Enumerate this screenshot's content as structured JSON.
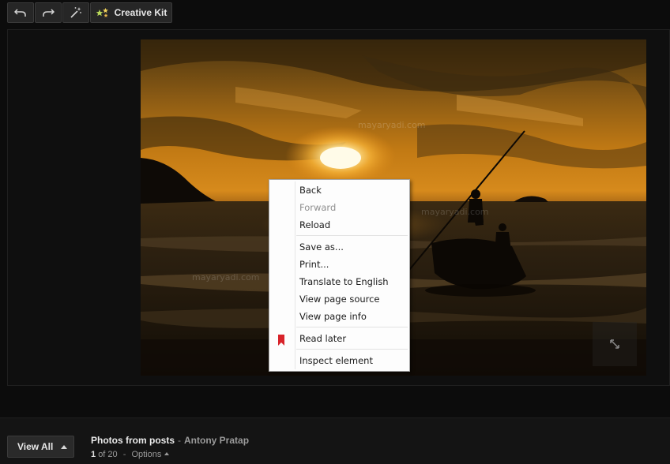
{
  "toolbar": {
    "undo_icon": "undo-icon",
    "redo_icon": "redo-icon",
    "autofix_icon": "magic-wand-icon",
    "creative_kit_label": "Creative Kit"
  },
  "photo": {
    "watermarks": [
      "mayaryadi.com",
      "mayaryadi.com",
      "mayaryadi.com"
    ]
  },
  "context_menu": {
    "items": [
      {
        "label": "Back",
        "enabled": true
      },
      {
        "label": "Forward",
        "enabled": false
      },
      {
        "label": "Reload",
        "enabled": true
      },
      {
        "label": "Save as...",
        "enabled": true
      },
      {
        "label": "Print...",
        "enabled": true
      },
      {
        "label": "Translate to English",
        "enabled": true
      },
      {
        "label": "View page source",
        "enabled": true
      },
      {
        "label": "View page info",
        "enabled": true
      },
      {
        "label": "Read later",
        "enabled": true,
        "icon": "bookmark-icon"
      },
      {
        "label": "Inspect element",
        "enabled": true
      }
    ]
  },
  "bottom": {
    "view_all_label": "View All",
    "album_title": "Photos from posts",
    "separator": "-",
    "author": "Antony Pratap",
    "position": "1",
    "of_total": "of 20",
    "options_label": "Options"
  },
  "colors": {
    "background": "#0c0c0c",
    "menu_bg": "#fdfdfd",
    "bookmark_red": "#d8232a"
  }
}
